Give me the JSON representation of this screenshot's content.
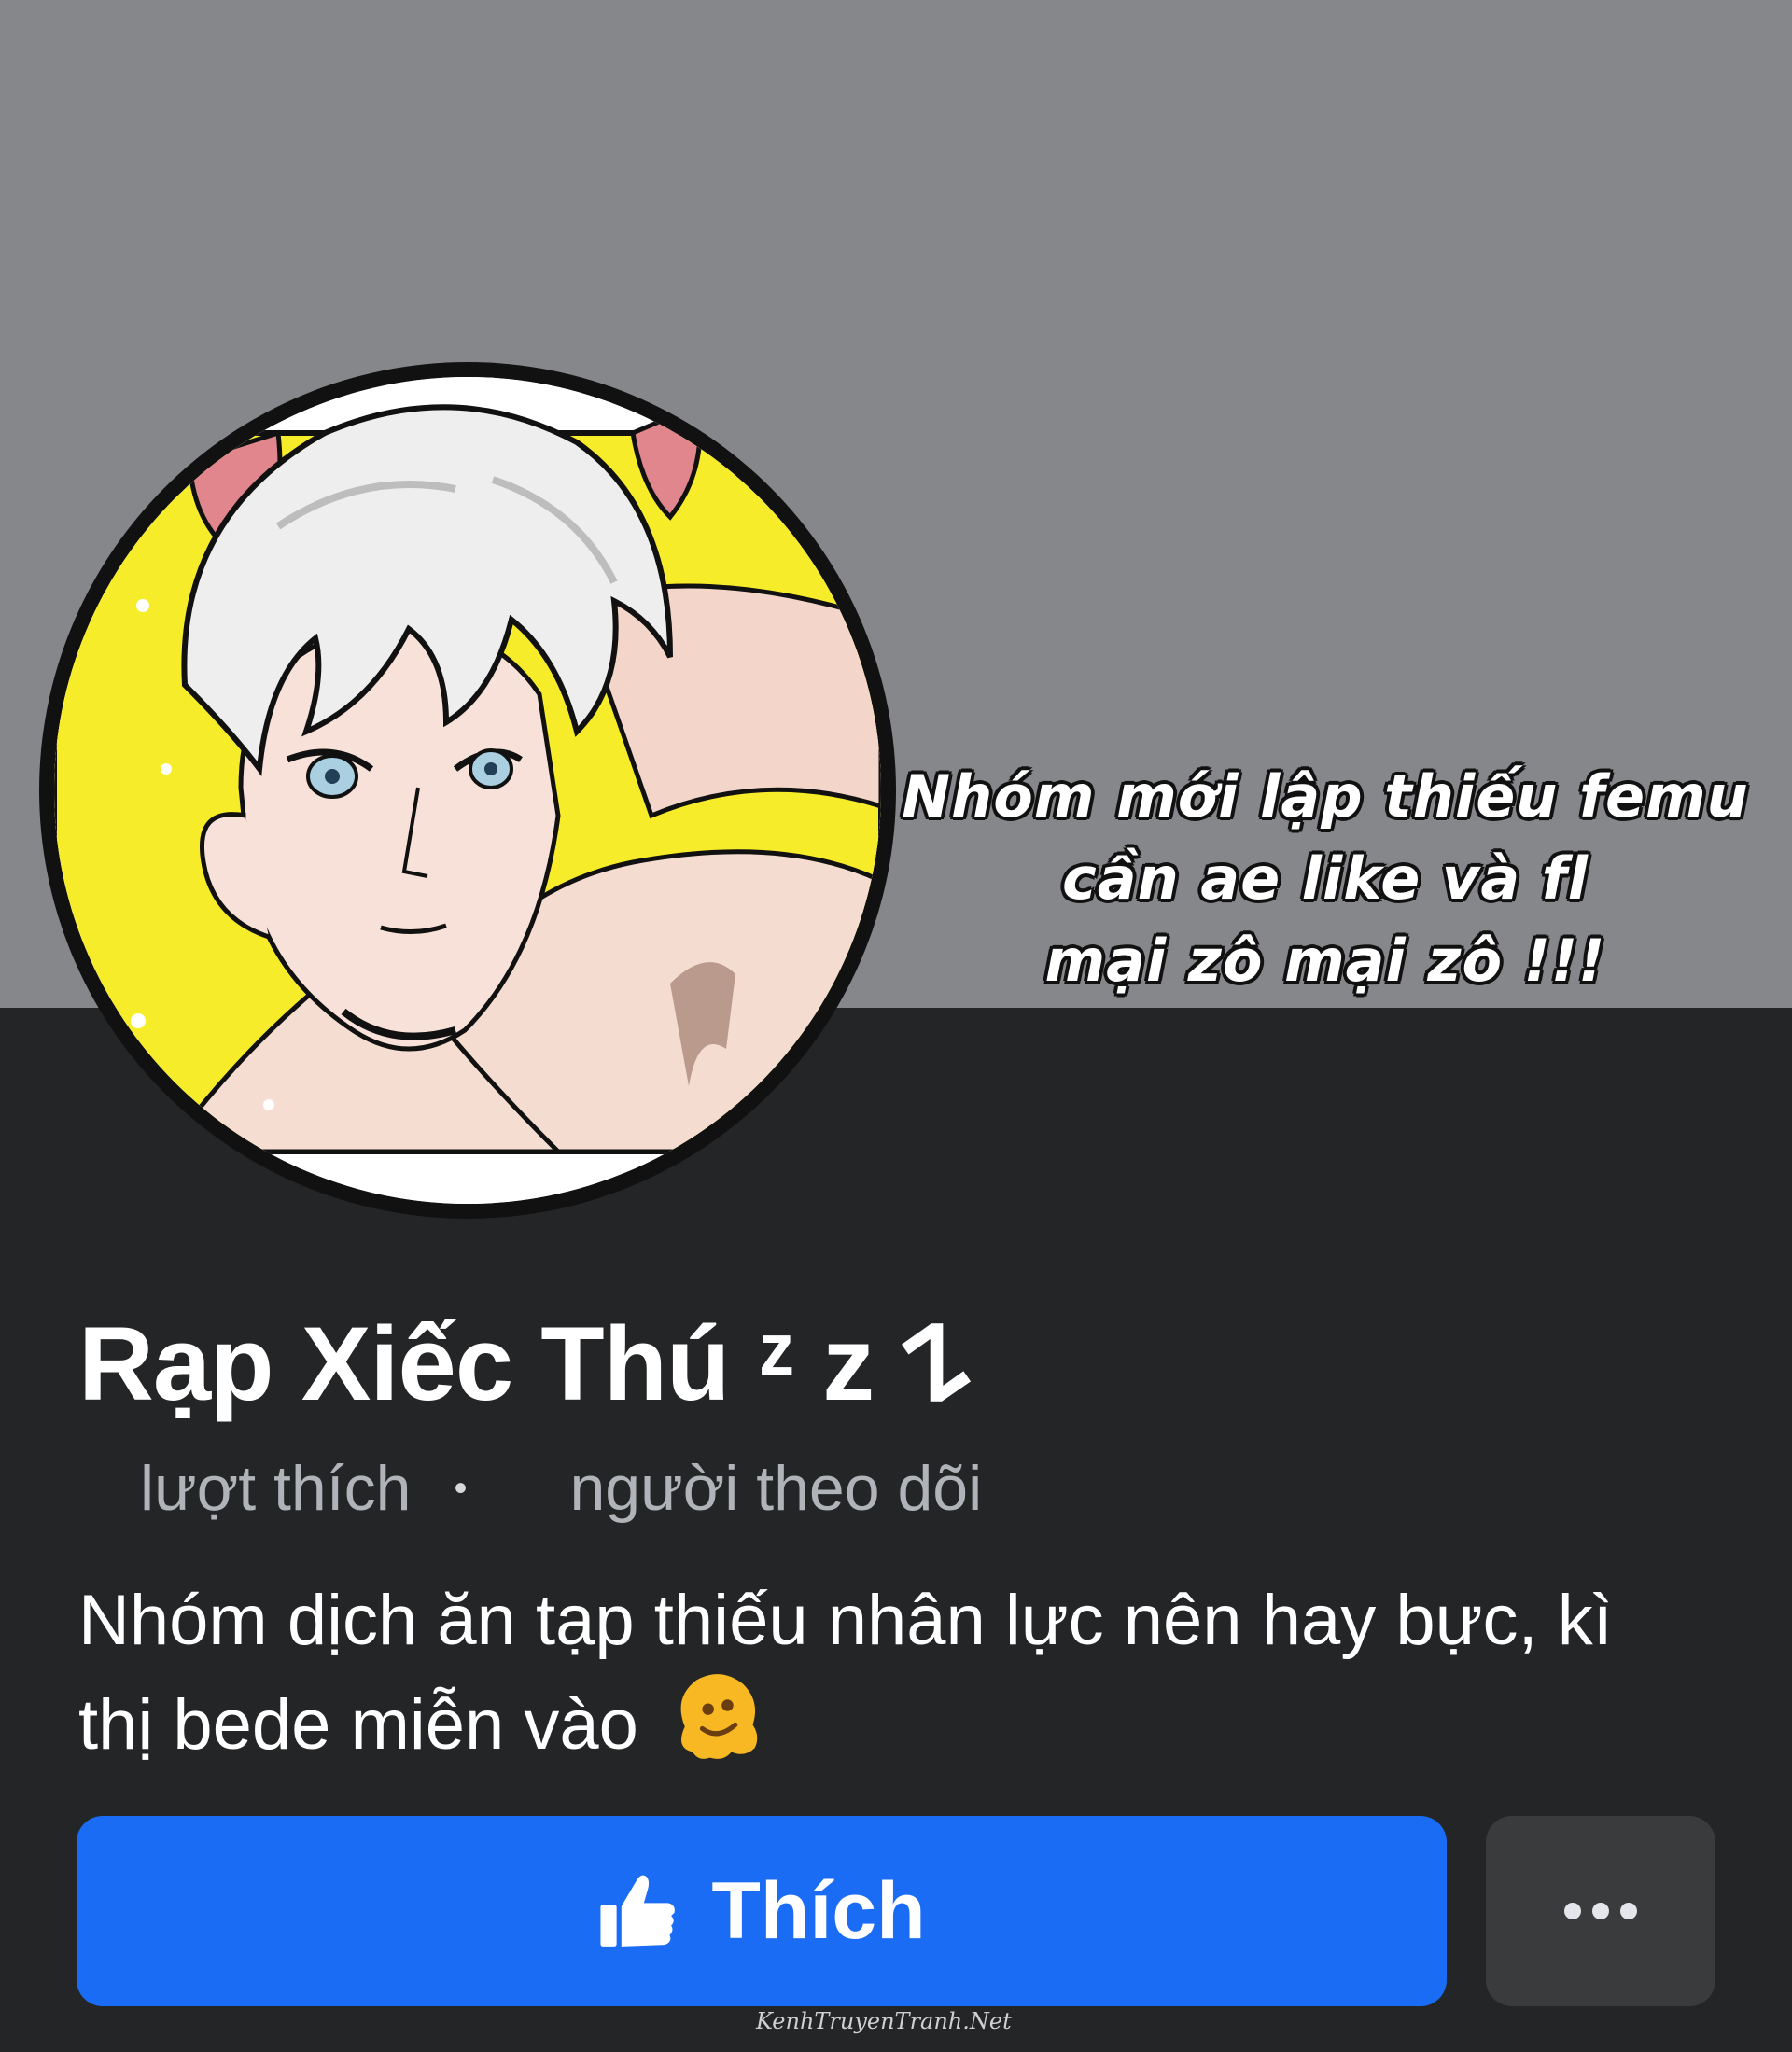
{
  "cover": {
    "caption_lines": [
      "Nhóm mới lập thiếu femu",
      "cần ae like và fl",
      "mại zô mại zô !!!"
    ]
  },
  "profile": {
    "name": "Rạp Xiếc Thú ᶻ z 𐰁",
    "likes_label": "lượt thích",
    "separator": "•",
    "followers_label": "người theo dõi",
    "bio": "Nhóm dịch ăn tạp thiếu nhân lực nên hay bực, kì thị bede miễn vào"
  },
  "actions": {
    "like_label": "Thích",
    "like_icon": "thumbs-up-icon",
    "more_icon": "more-horizontal-icon"
  },
  "watermark": "KenhTruyenTranh.Net",
  "colors": {
    "cover_bg": "#85878b",
    "page_bg": "#242526",
    "like_button": "#1a6cf4",
    "more_button": "#3a3b3c",
    "secondary_text": "#b0b3b8"
  }
}
